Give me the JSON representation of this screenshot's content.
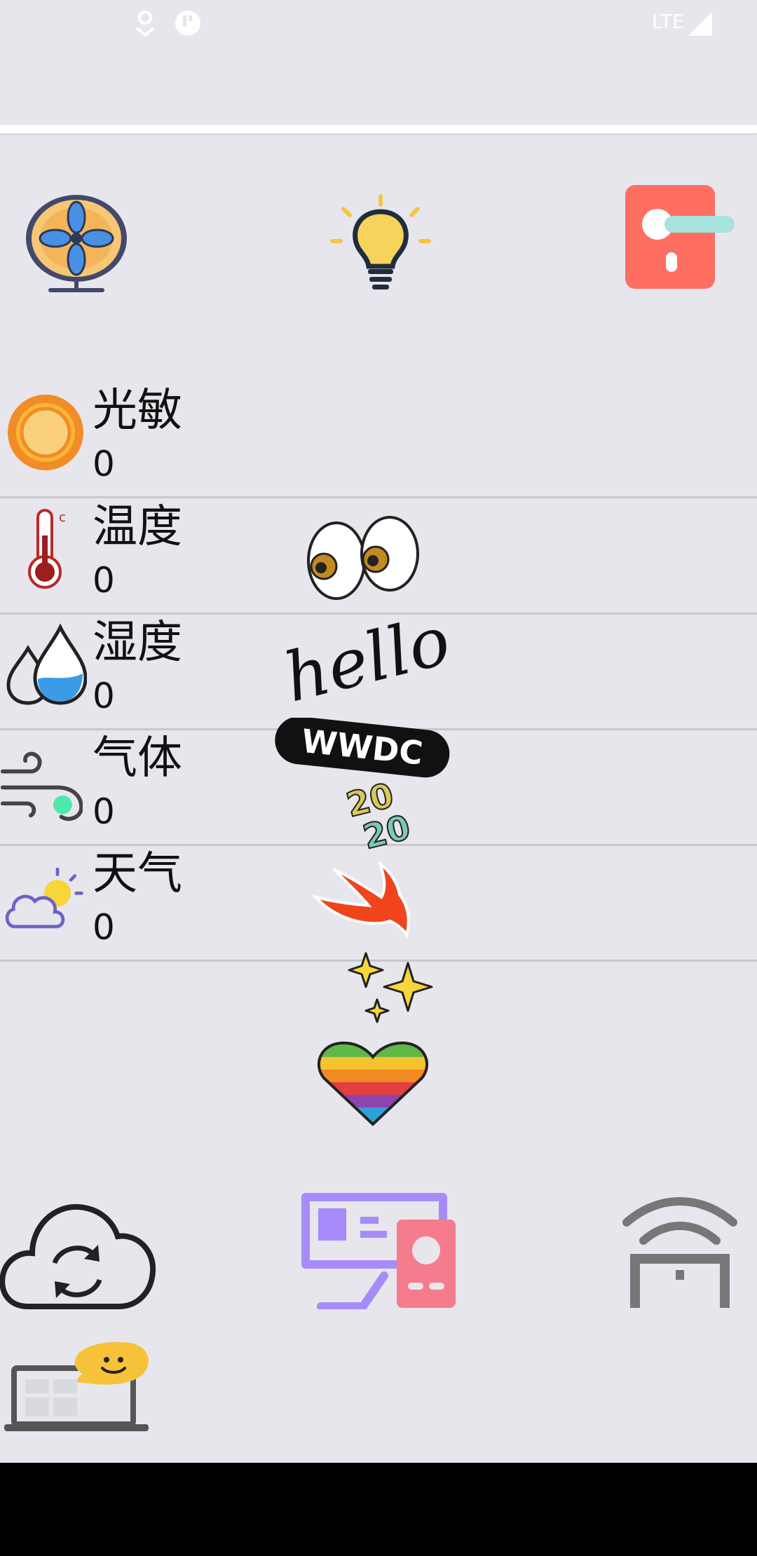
{
  "status_bar": {
    "network_label": "LTE",
    "icons": [
      "location-icon",
      "data-saver-icon",
      "signal-icon"
    ]
  },
  "devices": {
    "fan": {
      "icon": "fan-icon"
    },
    "light": {
      "icon": "lightbulb-icon"
    },
    "lock": {
      "icon": "door-lock-icon"
    }
  },
  "sensors": [
    {
      "label": "光敏",
      "value": "0",
      "icon": "sun-icon"
    },
    {
      "label": "温度",
      "value": "0",
      "icon": "thermometer-icon"
    },
    {
      "label": "湿度",
      "value": "0",
      "icon": "water-drops-icon"
    },
    {
      "label": "气体",
      "value": "0",
      "icon": "wind-gas-icon"
    },
    {
      "label": "天气",
      "value": "0",
      "icon": "weather-icon"
    }
  ],
  "decorations": {
    "hello_text": "hello",
    "wwdc_text": "WWDC",
    "year_top": "20",
    "year_bottom": "20"
  },
  "bottom_actions": [
    {
      "icon": "cloud-sync-icon"
    },
    {
      "icon": "devices-icon"
    },
    {
      "icon": "wifi-gate-icon"
    },
    {
      "icon": "laptop-chat-icon"
    }
  ],
  "colors": {
    "background": "#e8e6ed",
    "lock_red": "#ff6f61",
    "purple": "#a78bfa",
    "pink": "#f47c8c",
    "grey": "#777777"
  }
}
